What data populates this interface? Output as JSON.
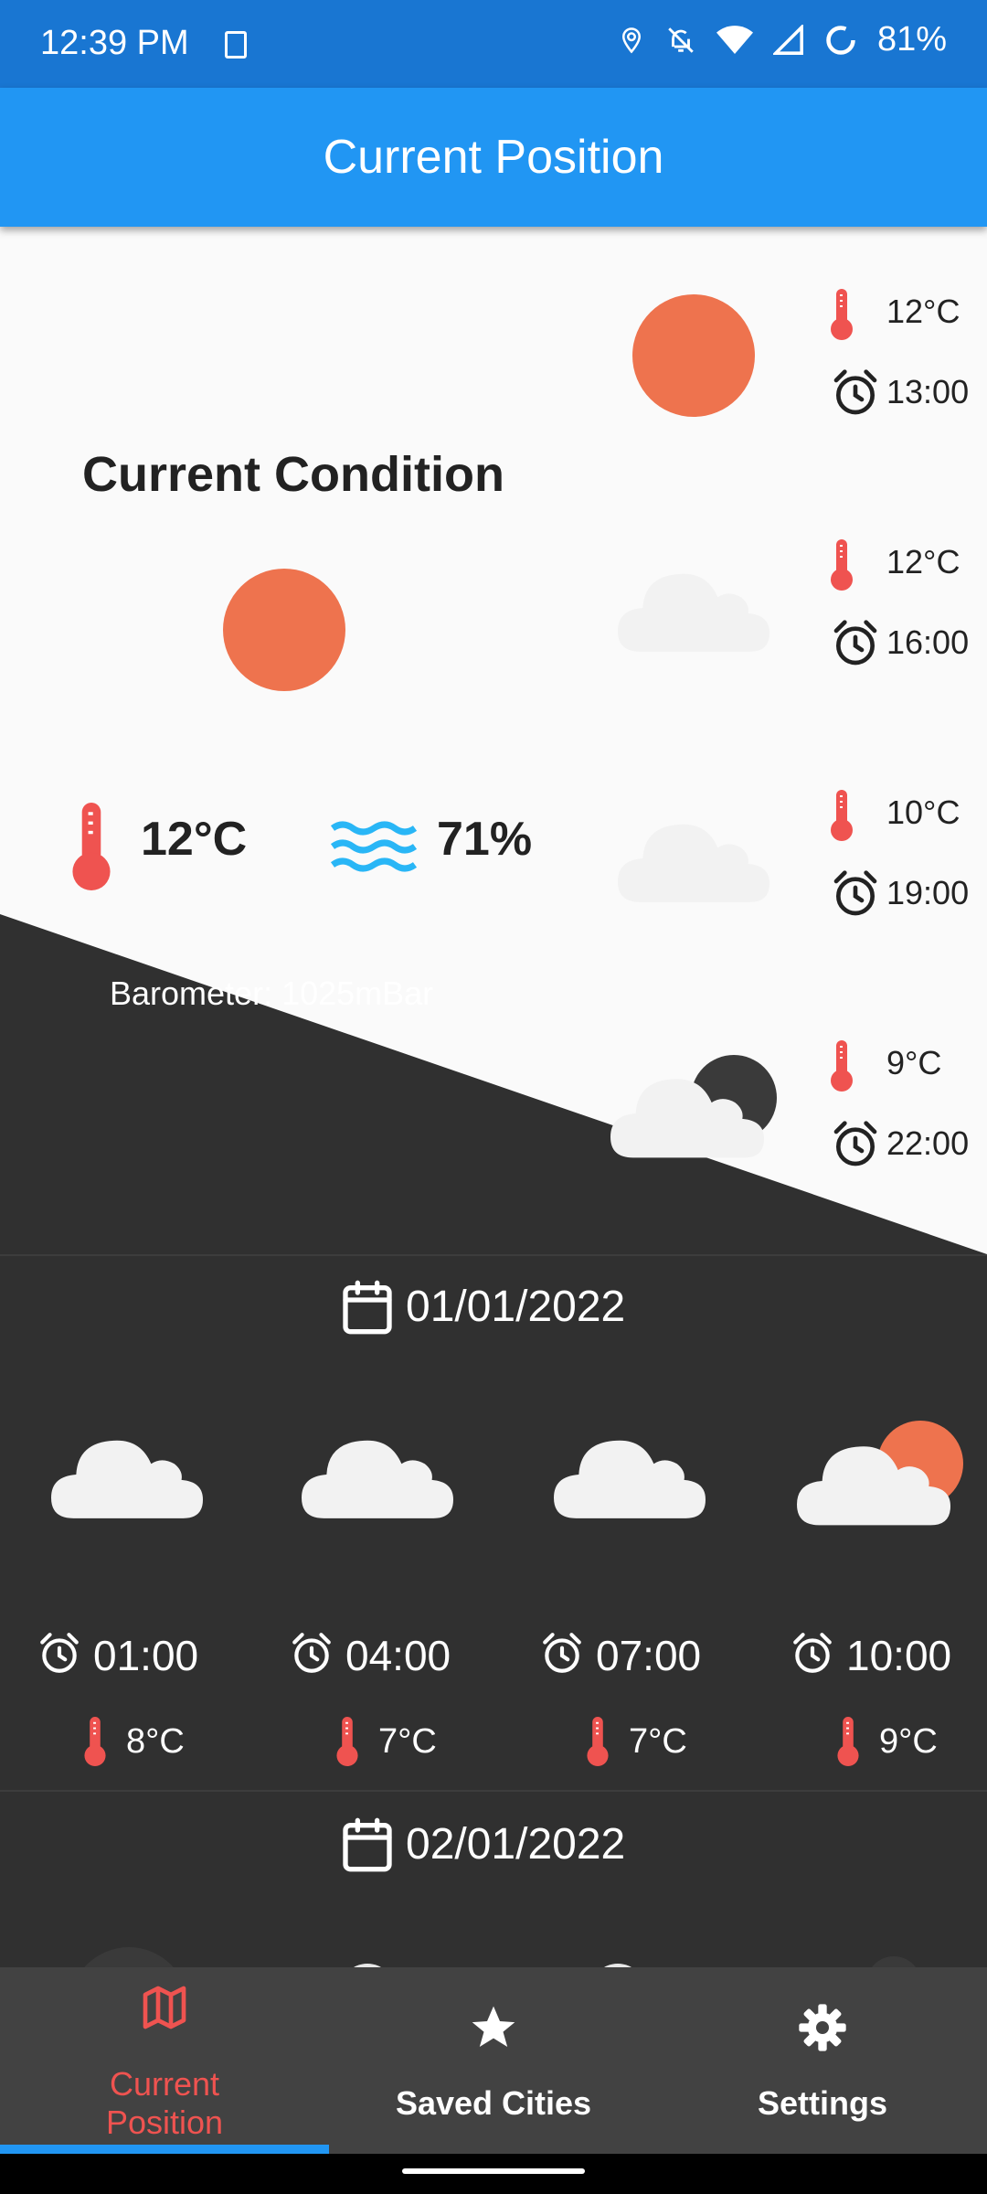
{
  "status_bar": {
    "time": "12:39 PM",
    "battery": "81%"
  },
  "app_bar": {
    "title": "Current Position"
  },
  "current": {
    "title": "Current Condition",
    "temperature": "12°C",
    "humidity": "71%",
    "barometer": "Barometer: 1025mBar"
  },
  "hourly": [
    {
      "temp": "12°C",
      "time": "13:00",
      "icon": "sun-icon"
    },
    {
      "temp": "12°C",
      "time": "16:00",
      "icon": "cloud-icon"
    },
    {
      "temp": "10°C",
      "time": "19:00",
      "icon": "cloud-icon"
    },
    {
      "temp": "9°C",
      "time": "22:00",
      "icon": "cloud-moon-icon"
    }
  ],
  "days": [
    {
      "date": "01/01/2022",
      "forecast": [
        {
          "time": "01:00",
          "temp": "8°C",
          "icon": "cloud-icon"
        },
        {
          "time": "04:00",
          "temp": "7°C",
          "icon": "cloud-icon"
        },
        {
          "time": "07:00",
          "temp": "7°C",
          "icon": "cloud-icon"
        },
        {
          "time": "10:00",
          "temp": "9°C",
          "icon": "cloud-sun-icon"
        }
      ]
    },
    {
      "date": "02/01/2022"
    }
  ],
  "bottom_nav": {
    "items": [
      {
        "label_line1": "Current",
        "label_line2": "Position",
        "icon": "map-icon",
        "active": true
      },
      {
        "label": "Saved Cities",
        "icon": "star-icon"
      },
      {
        "label": "Settings",
        "icon": "gear-icon"
      }
    ]
  },
  "colors": {
    "primary": "#2196F3",
    "status_bar": "#1976D2",
    "accent_red": "#EF5350",
    "sun": "#EE734E",
    "dark_bg": "#303030",
    "light_bg": "#FAFAFA",
    "water": "#29B6F6"
  }
}
